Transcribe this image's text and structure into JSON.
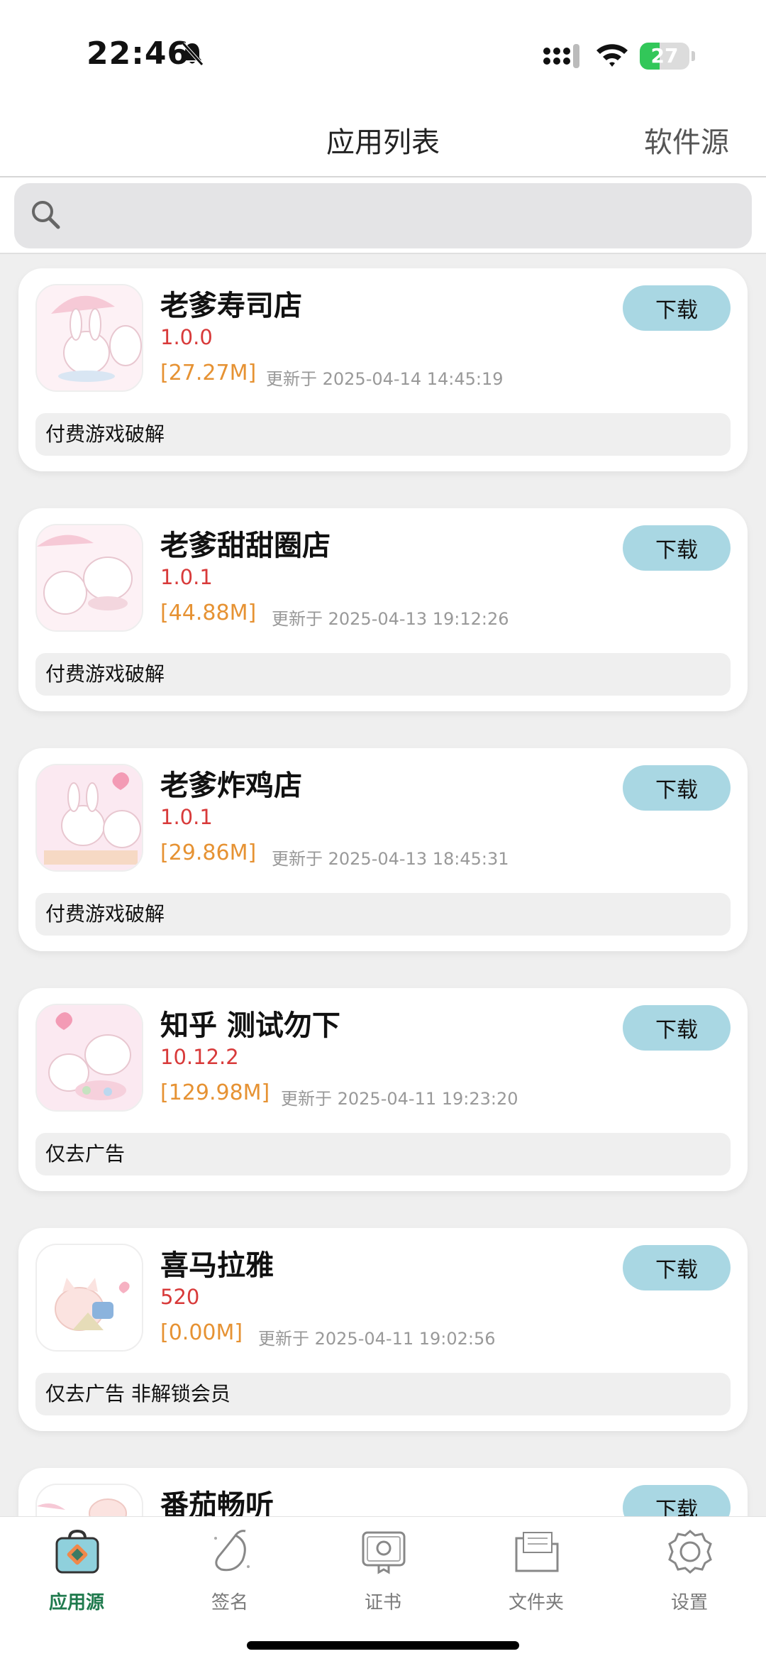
{
  "status": {
    "time": "22:46",
    "battery": "27"
  },
  "nav": {
    "title": "应用列表",
    "right_label": "软件源"
  },
  "search": {
    "placeholder": ""
  },
  "apps": [
    {
      "name": "老爹寿司店",
      "version": "1.0.0",
      "size": "[27.27M]",
      "updated": "更新于 2025-04-14 14:45:19",
      "tag": "付费游戏破解",
      "button": "下载"
    },
    {
      "name": "老爹甜甜圈店",
      "version": "1.0.1",
      "size": "[44.88M]",
      "updated": "更新于 2025-04-13 19:12:26",
      "tag": "付费游戏破解",
      "button": "下载"
    },
    {
      "name": "老爹炸鸡店",
      "version": "1.0.1",
      "size": "[29.86M]",
      "updated": "更新于 2025-04-13 18:45:31",
      "tag": "付费游戏破解",
      "button": "下载"
    },
    {
      "name": "知乎 测试勿下",
      "version": "10.12.2",
      "size": "[129.98M]",
      "updated": "更新于 2025-04-11 19:23:20",
      "tag": "仅去广告",
      "button": "下载"
    },
    {
      "name": "喜马拉雅",
      "version": "520",
      "size": "[0.00M]",
      "updated": "更新于 2025-04-11 19:02:56",
      "tag": "仅去广告 非解锁会员",
      "button": "下载"
    },
    {
      "name": "番茄畅听",
      "version": "",
      "size": "",
      "updated": "",
      "tag": "",
      "button": "下载"
    }
  ],
  "tabs": [
    {
      "label": "应用源",
      "icon": "bag-icon",
      "active": true
    },
    {
      "label": "签名",
      "icon": "mango-icon",
      "active": false
    },
    {
      "label": "证书",
      "icon": "certificate-icon",
      "active": false
    },
    {
      "label": "文件夹",
      "icon": "folder-icon",
      "active": false
    },
    {
      "label": "设置",
      "icon": "gear-icon",
      "active": false
    }
  ],
  "colors": {
    "accent": "#1f7a4d",
    "download_button": "#a9d7e3",
    "version": "#d83a3a",
    "size": "#e69233"
  }
}
